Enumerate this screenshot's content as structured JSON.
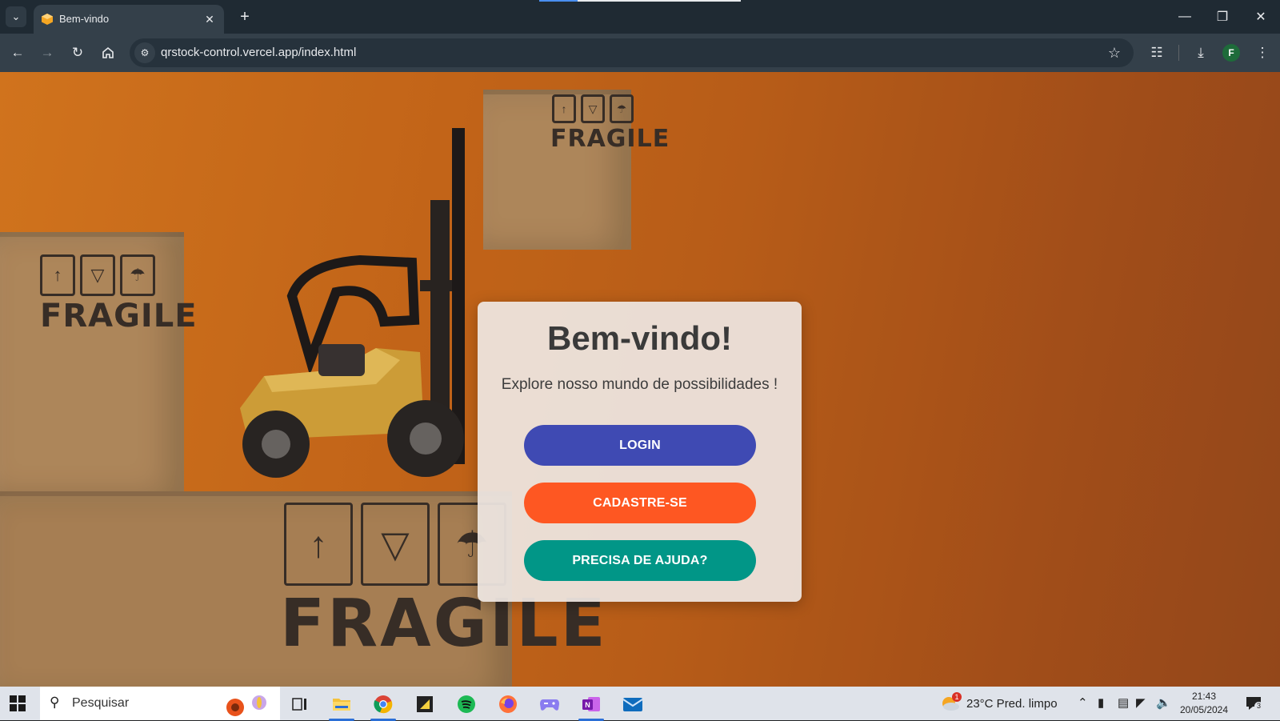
{
  "browser": {
    "tab_title": "Bem-vindo",
    "new_tab_symbol": "+",
    "url": "qrstock-control.vercel.app/index.html",
    "profile_initial": "F",
    "load_progress": 0.19
  },
  "page": {
    "title": "Bem-vindo!",
    "subtitle": "Explore nosso mundo de possibilidades !",
    "buttons": {
      "login": "LOGIN",
      "signup": "CADASTRE-SE",
      "help": "PRECISA DE AJUDA?"
    },
    "background_labels": [
      "FRAGILE",
      "FRAGILE",
      "FRAGILE"
    ],
    "colors": {
      "login": "#3f4ab3",
      "signup": "#fe5722",
      "help": "#019687",
      "background": "#c9681a"
    }
  },
  "taskbar": {
    "search_placeholder": "Pesquisar",
    "weather_badge": "1",
    "weather_text": "23°C  Pred. limpo",
    "time": "21:43",
    "date": "20/05/2024",
    "notification_count": "3",
    "pinned_icons": [
      "task-view-icon",
      "file-explorer-icon",
      "chrome-icon",
      "sticky-notes-icon",
      "spotify-icon",
      "firefox-icon",
      "game-controller-icon",
      "onenote-icon",
      "mail-icon"
    ]
  }
}
